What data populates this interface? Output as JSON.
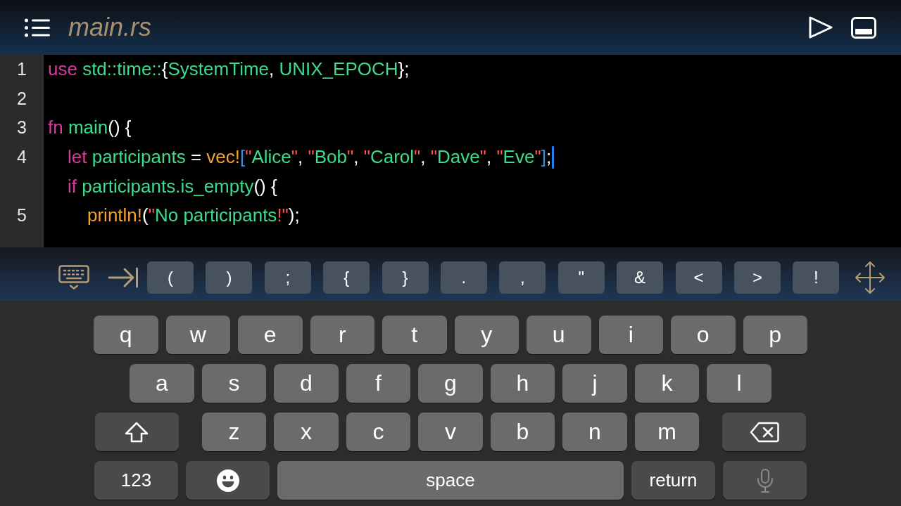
{
  "title_bar": {
    "title": "main.rs"
  },
  "code": {
    "lines": [
      {
        "number": "1",
        "caret": false,
        "tokens": [
          {
            "kind": "keyword",
            "text": "use"
          },
          {
            "kind": "ident",
            "text": " std::time::"
          },
          {
            "kind": "punct",
            "text": "{"
          },
          {
            "kind": "ident",
            "text": "SystemTime"
          },
          {
            "kind": "punct",
            "text": ", "
          },
          {
            "kind": "ident",
            "text": "UNIX_EPOCH"
          },
          {
            "kind": "punct",
            "text": "};"
          }
        ]
      },
      {
        "number": "2",
        "caret": false
      },
      {
        "number": "3",
        "caret": false,
        "tokens": [
          {
            "kind": "keyword",
            "text": "fn"
          },
          {
            "kind": "ident",
            "text": " main"
          },
          {
            "kind": "punct",
            "text": "() {"
          }
        ],
        "children": [
          {
            "number": "4",
            "caret": true,
            "tokens": [
              {
                "kind": "keyword",
                "text": "let"
              },
              {
                "kind": "ident",
                "text": " participants"
              },
              {
                "kind": "punct",
                "text": " = "
              },
              {
                "kind": "macro",
                "text": "vec!"
              },
              {
                "kind": "bracket",
                "text": "["
              },
              {
                "kind": "quote",
                "text": "\""
              },
              {
                "kind": "string",
                "text": "Alice"
              },
              {
                "kind": "quote",
                "text": "\""
              },
              {
                "kind": "punct",
                "text": ", "
              },
              {
                "kind": "quote",
                "text": "\""
              },
              {
                "kind": "string",
                "text": "Bob"
              },
              {
                "kind": "quote",
                "text": "\""
              },
              {
                "kind": "punct",
                "text": ", "
              },
              {
                "kind": "quote",
                "text": "\""
              },
              {
                "kind": "string",
                "text": "Carol"
              },
              {
                "kind": "quote",
                "text": "\""
              },
              {
                "kind": "punct",
                "text": ", "
              },
              {
                "kind": "quote",
                "text": "\""
              },
              {
                "kind": "string",
                "text": "Dave"
              },
              {
                "kind": "quote",
                "text": "\""
              },
              {
                "kind": "punct",
                "text": ", "
              },
              {
                "kind": "quote",
                "text": "\""
              },
              {
                "kind": "string",
                "text": "Eve"
              },
              {
                "kind": "quote",
                "text": "\""
              },
              {
                "kind": "bracket",
                "text": "]"
              },
              {
                "kind": "punct",
                "text": ";"
              }
            ]
          },
          {
            "caret": false,
            "tokens": [
              {
                "kind": "keyword",
                "text": "if"
              },
              {
                "kind": "ident",
                "text": " participants.is_empty"
              },
              {
                "kind": "punct",
                "text": "() {"
              }
            ],
            "children": [
              {
                "number": "5",
                "caret": false,
                "tokens": [
                  {
                    "kind": "macro",
                    "text": "println!"
                  },
                  {
                    "kind": "punct",
                    "text": "("
                  },
                  {
                    "kind": "quote",
                    "text": "\""
                  },
                  {
                    "kind": "string",
                    "text": "No participants"
                  },
                  {
                    "kind": "quote",
                    "text": "!\""
                  },
                  {
                    "kind": "punct",
                    "text": ");"
                  }
                ]
              }
            ]
          }
        ]
      }
    ]
  },
  "accessory_bar": {
    "keys": [
      "(",
      ")",
      ";",
      "{",
      "}",
      ".",
      ",",
      "\"",
      "&",
      "<",
      ">",
      "!"
    ]
  },
  "keyboard": {
    "rows": [
      {
        "keys": [
          {
            "kind": "letter",
            "label": "q"
          },
          {
            "kind": "letter",
            "label": "w"
          },
          {
            "kind": "letter",
            "label": "e"
          },
          {
            "kind": "letter",
            "label": "r"
          },
          {
            "kind": "letter",
            "label": "t"
          },
          {
            "kind": "letter",
            "label": "y"
          },
          {
            "kind": "letter",
            "label": "u"
          },
          {
            "kind": "letter",
            "label": "i"
          },
          {
            "kind": "letter",
            "label": "o"
          },
          {
            "kind": "letter",
            "label": "p"
          }
        ]
      },
      {
        "keys": [
          {
            "kind": "letter",
            "label": "a"
          },
          {
            "kind": "letter",
            "label": "s"
          },
          {
            "kind": "letter",
            "label": "d"
          },
          {
            "kind": "letter",
            "label": "f"
          },
          {
            "kind": "letter",
            "label": "g"
          },
          {
            "kind": "letter",
            "label": "h"
          },
          {
            "kind": "letter",
            "label": "j"
          },
          {
            "kind": "letter",
            "label": "k"
          },
          {
            "kind": "letter",
            "label": "l"
          }
        ]
      },
      {
        "keys": [
          {
            "kind": "shift"
          },
          {
            "kind": "letter",
            "label": "z"
          },
          {
            "kind": "letter",
            "label": "x"
          },
          {
            "kind": "letter",
            "label": "c"
          },
          {
            "kind": "letter",
            "label": "v"
          },
          {
            "kind": "letter",
            "label": "b"
          },
          {
            "kind": "letter",
            "label": "n"
          },
          {
            "kind": "letter",
            "label": "m"
          },
          {
            "kind": "delete"
          }
        ]
      },
      {
        "keys": [
          {
            "kind": "numbers",
            "label": "123"
          },
          {
            "kind": "emoji"
          },
          {
            "kind": "space",
            "label": "space"
          },
          {
            "kind": "return",
            "label": "return"
          },
          {
            "kind": "mic"
          }
        ]
      }
    ]
  }
}
